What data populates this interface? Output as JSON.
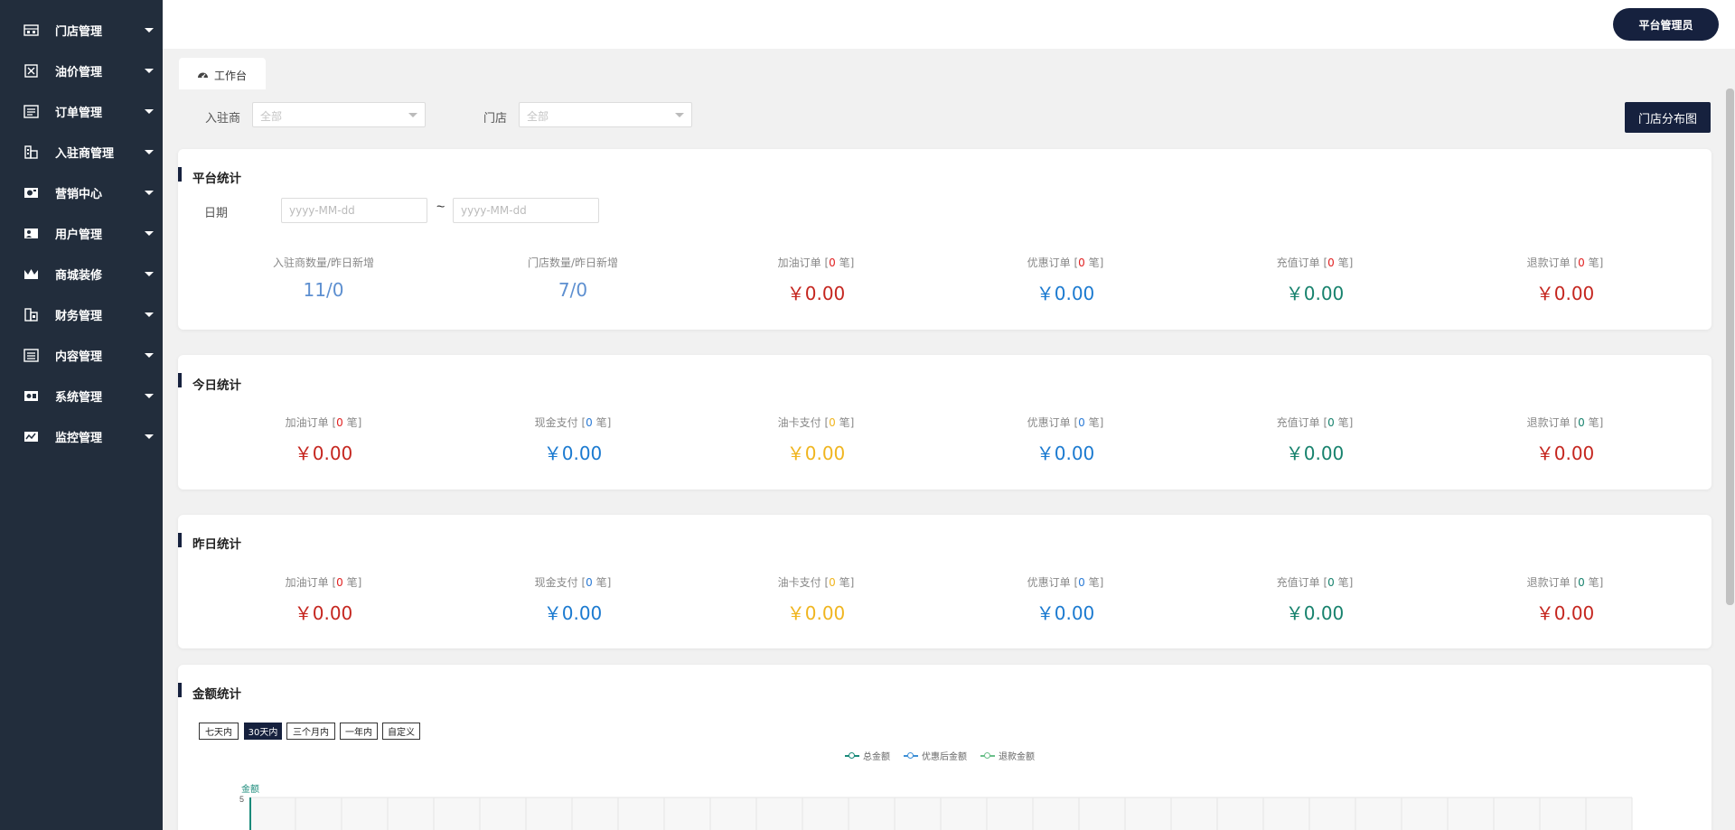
{
  "sidebar": {
    "items": [
      {
        "label": "门店管理",
        "icon": "store-icon"
      },
      {
        "label": "油价管理",
        "icon": "price-tag-icon"
      },
      {
        "label": "订单管理",
        "icon": "list-icon"
      },
      {
        "label": "入驻商管理",
        "icon": "building-icon"
      },
      {
        "label": "营销中心",
        "icon": "marketing-icon"
      },
      {
        "label": "用户管理",
        "icon": "user-icon"
      },
      {
        "label": "商城装修",
        "icon": "crown-icon"
      },
      {
        "label": "财务管理",
        "icon": "finance-icon"
      },
      {
        "label": "内容管理",
        "icon": "content-icon"
      },
      {
        "label": "系统管理",
        "icon": "settings-icon"
      },
      {
        "label": "监控管理",
        "icon": "monitor-icon"
      }
    ]
  },
  "header": {
    "admin_label": "平台管理员"
  },
  "tabs": [
    {
      "label": "工作台",
      "icon": "dashboard-icon"
    }
  ],
  "filters": {
    "merchant_label": "入驻商",
    "merchant_value": "全部",
    "store_label": "门店",
    "store_value": "全部",
    "map_button": "门店分布图"
  },
  "platform": {
    "title": "平台统计",
    "date_label": "日期",
    "date_start_placeholder": "yyyy-MM-dd",
    "date_sep": "~",
    "date_end_placeholder": "yyyy-MM-dd",
    "stats": [
      {
        "label": "入驻商数量/昨日新增",
        "value": "11/0"
      },
      {
        "label": "门店数量/昨日新增",
        "value": "7/0"
      },
      {
        "prefix": "加油订单 [",
        "count": "0",
        "suffix": " 笔]",
        "value": "￥0.00"
      },
      {
        "prefix": "优惠订单 [",
        "count": "0",
        "suffix": " 笔]",
        "value": "￥0.00"
      },
      {
        "prefix": "充值订单 [",
        "count": "0",
        "suffix": " 笔]",
        "value": "￥0.00"
      },
      {
        "prefix": "退款订单 [",
        "count": "0",
        "suffix": " 笔]",
        "value": "￥0.00"
      }
    ]
  },
  "today": {
    "title": "今日统计",
    "stats": [
      {
        "prefix": "加油订单 [",
        "count": "0",
        "suffix": " 笔]",
        "value": "￥0.00"
      },
      {
        "prefix": "现金支付 [",
        "count": "0",
        "suffix": " 笔]",
        "value": "￥0.00"
      },
      {
        "prefix": "油卡支付 [",
        "count": "0",
        "suffix": " 笔]",
        "value": "￥0.00"
      },
      {
        "prefix": "优惠订单 [",
        "count": "0",
        "suffix": " 笔]",
        "value": "￥0.00"
      },
      {
        "prefix": "充值订单 [",
        "count": "0",
        "suffix": " 笔]",
        "value": "￥0.00"
      },
      {
        "prefix": "退款订单 [",
        "count": "0",
        "suffix": " 笔]",
        "value": "￥0.00"
      }
    ]
  },
  "yesterday": {
    "title": "昨日统计",
    "stats": [
      {
        "prefix": "加油订单 [",
        "count": "0",
        "suffix": " 笔]",
        "value": "￥0.00"
      },
      {
        "prefix": "现金支付 [",
        "count": "0",
        "suffix": " 笔]",
        "value": "￥0.00"
      },
      {
        "prefix": "油卡支付 [",
        "count": "0",
        "suffix": " 笔]",
        "value": "￥0.00"
      },
      {
        "prefix": "优惠订单 [",
        "count": "0",
        "suffix": " 笔]",
        "value": "￥0.00"
      },
      {
        "prefix": "充值订单 [",
        "count": "0",
        "suffix": " 笔]",
        "value": "￥0.00"
      },
      {
        "prefix": "退款订单 [",
        "count": "0",
        "suffix": " 笔]",
        "value": "￥0.00"
      }
    ]
  },
  "amount": {
    "title": "金额统计",
    "ranges": [
      "七天内",
      "30天内",
      "三个月内",
      "一年内",
      "自定义"
    ],
    "active_range": "30天内",
    "legend": [
      {
        "name": "总金额",
        "color": "#1a8a7a"
      },
      {
        "name": "优惠后金额",
        "color": "#3d8fd6"
      },
      {
        "name": "退款金额",
        "color": "#6bbf8a"
      }
    ],
    "y_axis_name": "金额",
    "y_tick_top": "5"
  },
  "colors": {
    "sidebar_bg": "#222d3c",
    "accent": "#16213e",
    "red": "#c5261f",
    "blue": "#1b7ad0",
    "orange": "#f0b51f",
    "teal": "#17826d"
  }
}
